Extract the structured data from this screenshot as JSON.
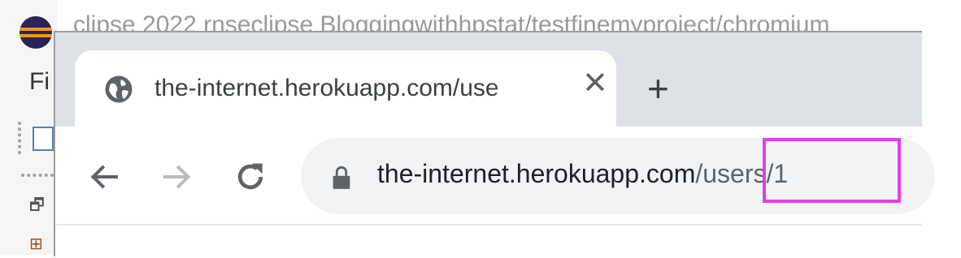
{
  "ide": {
    "menu_label": "Fi",
    "title_fragment": "clipse 2022    rnseclipse    Bloggingwithhpstat/testfinemyproject/chromium"
  },
  "browser": {
    "tab": {
      "title": "the-internet.herokuapp.com/use",
      "icon": "globe-icon",
      "close_glyph": "✕"
    },
    "new_tab_glyph": "+",
    "nav": {
      "back_icon": "arrow-left-icon",
      "forward_icon": "arrow-right-icon",
      "reload_icon": "reload-icon"
    },
    "address_bar": {
      "lock_icon": "lock-icon",
      "domain": "the-internet.herokuapp.com",
      "path": "/users/1"
    }
  },
  "annotation": {
    "highlight_color": "#e040e6"
  }
}
